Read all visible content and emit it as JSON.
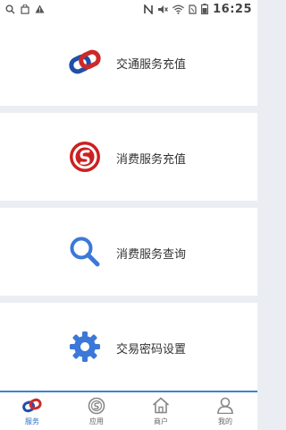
{
  "status_bar": {
    "time": "16:25",
    "left_icons": [
      "search-icon",
      "bag-icon",
      "warning-icon"
    ],
    "right_icons": [
      "nfc-icon",
      "mute-icon",
      "wifi-icon",
      "sim-icon",
      "battery-icon"
    ]
  },
  "services": [
    {
      "label": "交通服务充值",
      "icon": "transit-card-icon",
      "icon_color": "#cc2a2a"
    },
    {
      "label": "消费服务充值",
      "icon": "consumer-card-icon",
      "icon_color": "#cc2020"
    },
    {
      "label": "消费服务查询",
      "icon": "search-icon",
      "icon_color": "#3b78d8"
    },
    {
      "label": "交易密码设置",
      "icon": "gear-icon",
      "icon_color": "#3b78d8"
    }
  ],
  "bottom_nav": {
    "items": [
      {
        "label": "服务",
        "icon": "service-icon",
        "active": true
      },
      {
        "label": "应用",
        "icon": "app-icon",
        "active": false
      },
      {
        "label": "商户",
        "icon": "merchant-icon",
        "active": false
      },
      {
        "label": "我的",
        "icon": "profile-icon",
        "active": false
      }
    ]
  },
  "colors": {
    "accent": "#2a6fc0",
    "divider": "#eaeef2",
    "nav_border": "#3a86c8"
  }
}
